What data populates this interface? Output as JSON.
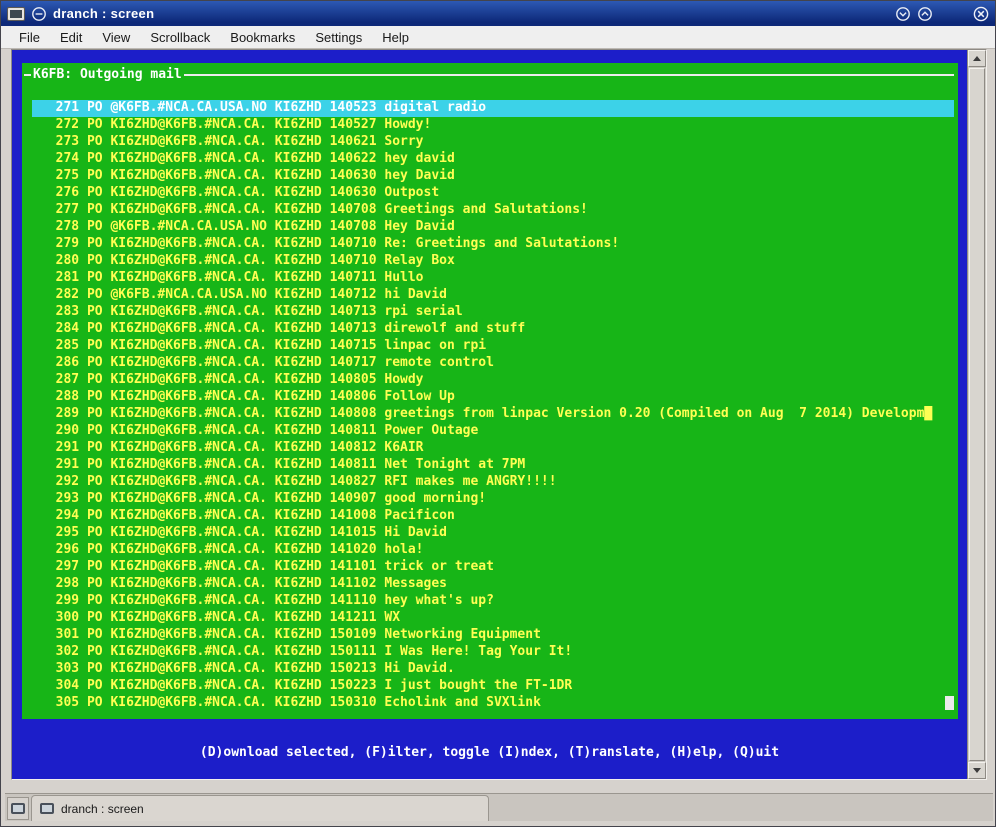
{
  "window": {
    "title": "dranch : screen",
    "icons": {
      "app": "konsole-terminal-icon",
      "sticky": "sticky-circle-icon",
      "minimize": "minimize-chevron-down-icon",
      "maximize": "maximize-chevron-up-icon",
      "close": "close-x-icon"
    }
  },
  "menubar": {
    "items": [
      "File",
      "Edit",
      "View",
      "Scrollback",
      "Bookmarks",
      "Settings",
      "Help"
    ]
  },
  "terminal": {
    "box_title": "K6FB: Outgoing mail",
    "status_line": "(D)ownload selected, (F)ilter, toggle (I)ndex, (T)ranslate, (H)elp, (Q)uit",
    "selected_index": 0,
    "mail": [
      {
        "num": 271,
        "flag": "PO",
        "addr": "@K6FB.#NCA.CA.USA.NO",
        "from": "KI6ZHD",
        "date": "140523",
        "subject": "digital radio"
      },
      {
        "num": 272,
        "flag": "PO",
        "addr": "KI6ZHD@K6FB.#NCA.CA.",
        "from": "KI6ZHD",
        "date": "140527",
        "subject": "Howdy!"
      },
      {
        "num": 273,
        "flag": "PO",
        "addr": "KI6ZHD@K6FB.#NCA.CA.",
        "from": "KI6ZHD",
        "date": "140621",
        "subject": "Sorry"
      },
      {
        "num": 274,
        "flag": "PO",
        "addr": "KI6ZHD@K6FB.#NCA.CA.",
        "from": "KI6ZHD",
        "date": "140622",
        "subject": "hey david"
      },
      {
        "num": 275,
        "flag": "PO",
        "addr": "KI6ZHD@K6FB.#NCA.CA.",
        "from": "KI6ZHD",
        "date": "140630",
        "subject": "hey David"
      },
      {
        "num": 276,
        "flag": "PO",
        "addr": "KI6ZHD@K6FB.#NCA.CA.",
        "from": "KI6ZHD",
        "date": "140630",
        "subject": "Outpost"
      },
      {
        "num": 277,
        "flag": "PO",
        "addr": "KI6ZHD@K6FB.#NCA.CA.",
        "from": "KI6ZHD",
        "date": "140708",
        "subject": "Greetings and Salutations!"
      },
      {
        "num": 278,
        "flag": "PO",
        "addr": "@K6FB.#NCA.CA.USA.NO",
        "from": "KI6ZHD",
        "date": "140708",
        "subject": "Hey David"
      },
      {
        "num": 279,
        "flag": "PO",
        "addr": "KI6ZHD@K6FB.#NCA.CA.",
        "from": "KI6ZHD",
        "date": "140710",
        "subject": "Re: Greetings and Salutations!"
      },
      {
        "num": 280,
        "flag": "PO",
        "addr": "KI6ZHD@K6FB.#NCA.CA.",
        "from": "KI6ZHD",
        "date": "140710",
        "subject": "Relay Box"
      },
      {
        "num": 281,
        "flag": "PO",
        "addr": "KI6ZHD@K6FB.#NCA.CA.",
        "from": "KI6ZHD",
        "date": "140711",
        "subject": "Hullo"
      },
      {
        "num": 282,
        "flag": "PO",
        "addr": "@K6FB.#NCA.CA.USA.NO",
        "from": "KI6ZHD",
        "date": "140712",
        "subject": "hi David"
      },
      {
        "num": 283,
        "flag": "PO",
        "addr": "KI6ZHD@K6FB.#NCA.CA.",
        "from": "KI6ZHD",
        "date": "140713",
        "subject": "rpi serial"
      },
      {
        "num": 284,
        "flag": "PO",
        "addr": "KI6ZHD@K6FB.#NCA.CA.",
        "from": "KI6ZHD",
        "date": "140713",
        "subject": "direwolf and stuff"
      },
      {
        "num": 285,
        "flag": "PO",
        "addr": "KI6ZHD@K6FB.#NCA.CA.",
        "from": "KI6ZHD",
        "date": "140715",
        "subject": "linpac on rpi"
      },
      {
        "num": 286,
        "flag": "PO",
        "addr": "KI6ZHD@K6FB.#NCA.CA.",
        "from": "KI6ZHD",
        "date": "140717",
        "subject": "remote control"
      },
      {
        "num": 287,
        "flag": "PO",
        "addr": "KI6ZHD@K6FB.#NCA.CA.",
        "from": "KI6ZHD",
        "date": "140805",
        "subject": "Howdy"
      },
      {
        "num": 288,
        "flag": "PO",
        "addr": "KI6ZHD@K6FB.#NCA.CA.",
        "from": "KI6ZHD",
        "date": "140806",
        "subject": "Follow Up"
      },
      {
        "num": 289,
        "flag": "PO",
        "addr": "KI6ZHD@K6FB.#NCA.CA.",
        "from": "KI6ZHD",
        "date": "140808",
        "subject": "greetings from linpac Version 0.20 (Compiled on Aug  7 2014) Developm█"
      },
      {
        "num": 290,
        "flag": "PO",
        "addr": "KI6ZHD@K6FB.#NCA.CA.",
        "from": "KI6ZHD",
        "date": "140811",
        "subject": "Power Outage"
      },
      {
        "num": 291,
        "flag": "PO",
        "addr": "KI6ZHD@K6FB.#NCA.CA.",
        "from": "KI6ZHD",
        "date": "140812",
        "subject": "K6AIR"
      },
      {
        "num": 291,
        "flag": "PO",
        "addr": "KI6ZHD@K6FB.#NCA.CA.",
        "from": "KI6ZHD",
        "date": "140811",
        "subject": "Net Tonight at 7PM"
      },
      {
        "num": 292,
        "flag": "PO",
        "addr": "KI6ZHD@K6FB.#NCA.CA.",
        "from": "KI6ZHD",
        "date": "140827",
        "subject": "RFI makes me ANGRY!!!!"
      },
      {
        "num": 293,
        "flag": "PO",
        "addr": "KI6ZHD@K6FB.#NCA.CA.",
        "from": "KI6ZHD",
        "date": "140907",
        "subject": "good morning!"
      },
      {
        "num": 294,
        "flag": "PO",
        "addr": "KI6ZHD@K6FB.#NCA.CA.",
        "from": "KI6ZHD",
        "date": "141008",
        "subject": "Pacificon"
      },
      {
        "num": 295,
        "flag": "PO",
        "addr": "KI6ZHD@K6FB.#NCA.CA.",
        "from": "KI6ZHD",
        "date": "141015",
        "subject": "Hi David"
      },
      {
        "num": 296,
        "flag": "PO",
        "addr": "KI6ZHD@K6FB.#NCA.CA.",
        "from": "KI6ZHD",
        "date": "141020",
        "subject": "hola!"
      },
      {
        "num": 297,
        "flag": "PO",
        "addr": "KI6ZHD@K6FB.#NCA.CA.",
        "from": "KI6ZHD",
        "date": "141101",
        "subject": "trick or treat"
      },
      {
        "num": 298,
        "flag": "PO",
        "addr": "KI6ZHD@K6FB.#NCA.CA.",
        "from": "KI6ZHD",
        "date": "141102",
        "subject": "Messages"
      },
      {
        "num": 299,
        "flag": "PO",
        "addr": "KI6ZHD@K6FB.#NCA.CA.",
        "from": "KI6ZHD",
        "date": "141110",
        "subject": "hey what's up?"
      },
      {
        "num": 300,
        "flag": "PO",
        "addr": "KI6ZHD@K6FB.#NCA.CA.",
        "from": "KI6ZHD",
        "date": "141211",
        "subject": "WX"
      },
      {
        "num": 301,
        "flag": "PO",
        "addr": "KI6ZHD@K6FB.#NCA.CA.",
        "from": "KI6ZHD",
        "date": "150109",
        "subject": "Networking Equipment"
      },
      {
        "num": 302,
        "flag": "PO",
        "addr": "KI6ZHD@K6FB.#NCA.CA.",
        "from": "KI6ZHD",
        "date": "150111",
        "subject": "I Was Here! Tag Your It!"
      },
      {
        "num": 303,
        "flag": "PO",
        "addr": "KI6ZHD@K6FB.#NCA.CA.",
        "from": "KI6ZHD",
        "date": "150213",
        "subject": "Hi David."
      },
      {
        "num": 304,
        "flag": "PO",
        "addr": "KI6ZHD@K6FB.#NCA.CA.",
        "from": "KI6ZHD",
        "date": "150223",
        "subject": "I just bought the FT-1DR"
      },
      {
        "num": 305,
        "flag": "PO",
        "addr": "KI6ZHD@K6FB.#NCA.CA.",
        "from": "KI6ZHD",
        "date": "150310",
        "subject": "Echolink and SVXlink"
      }
    ]
  },
  "tabbar": {
    "tab_label": "dranch : screen"
  },
  "colors": {
    "terminal_bg": "#1c1ec9",
    "panel_green": "#17b517",
    "text_yellow": "#ffff54",
    "selected_bg": "#3cd2e8",
    "selected_text": "#ffffff",
    "titlebar_top": "#2d59b4",
    "titlebar_bottom": "#0d2878"
  }
}
